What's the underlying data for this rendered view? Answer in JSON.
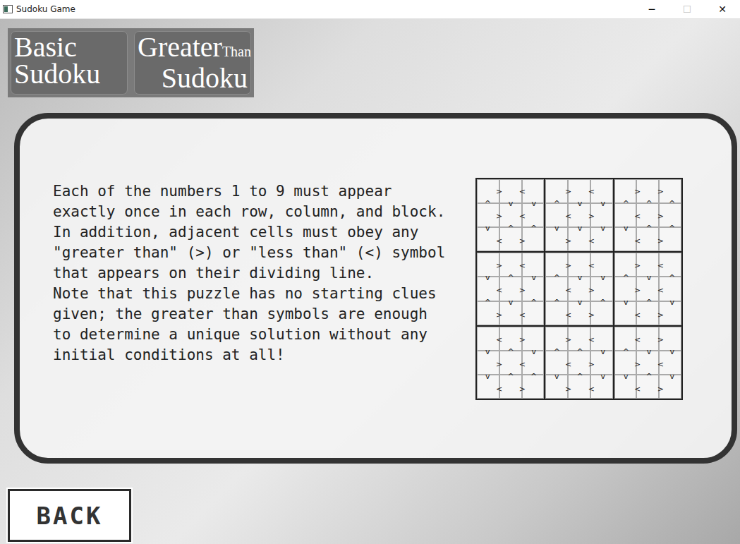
{
  "window": {
    "title": "Sudoku Game",
    "controls": [
      {
        "label": "─",
        "disabled": false
      },
      {
        "label": "☐",
        "disabled": true
      },
      {
        "label": "✕",
        "disabled": false
      }
    ]
  },
  "modes": [
    {
      "kind": "left",
      "title": "Basic",
      "subtitle": "Sudoku"
    },
    {
      "kind": "right",
      "title": "Greater",
      "suffix": "Than",
      "subtitle": "Sudoku"
    }
  ],
  "description": [
    "Each of the numbers 1 to 9 must appear",
    "exactly once in each row, column, and block.",
    "In addition, adjacent cells must obey any",
    "\"greater than\" (>) or \"less than\" (<) symbol",
    "that appears on their dividing line.",
    "Note that this puzzle has no starting clues",
    "given; the greater than symbols are enough",
    "to determine a unique solution without any",
    "initial conditions at all!"
  ],
  "grid": {
    "h": [
      [
        ">",
        "<",
        ">",
        "<",
        ">",
        ">"
      ],
      [
        ">",
        "<",
        "<",
        ">",
        "<",
        ">"
      ],
      [
        "<",
        ">",
        ">",
        "<",
        "<",
        ">"
      ],
      [
        ">",
        "<",
        ">",
        "<",
        ">",
        "<"
      ],
      [
        "<",
        ">",
        "<",
        ">",
        ">",
        "<"
      ],
      [
        ">",
        "<",
        "<",
        ">",
        "<",
        ">"
      ],
      [
        "<",
        ">",
        ">",
        "<",
        "<",
        ">"
      ],
      [
        ">",
        "<",
        "<",
        ">",
        ">",
        "<"
      ],
      [
        "<",
        ">",
        ">",
        "<",
        "<",
        ">"
      ]
    ],
    "v": [
      [
        "^",
        "v",
        "v",
        "^",
        "v",
        "v",
        "^",
        "^",
        "^"
      ],
      [
        "v",
        "^",
        "^",
        "v",
        "v",
        "v",
        "v",
        "^",
        "^"
      ],
      [
        "v",
        "^",
        "v",
        "^",
        "v",
        "v",
        "^",
        "v",
        "^"
      ],
      [
        "^",
        "v",
        "^",
        "^",
        "v",
        "^",
        "v",
        "^",
        "v"
      ],
      [
        "v",
        "^",
        "v",
        "^",
        "^",
        "v",
        "^",
        "v",
        "v"
      ],
      [
        "v",
        "^",
        "^",
        "v",
        "^",
        "v",
        "v",
        "^",
        "v"
      ]
    ]
  },
  "back": {
    "label": "BACK"
  }
}
